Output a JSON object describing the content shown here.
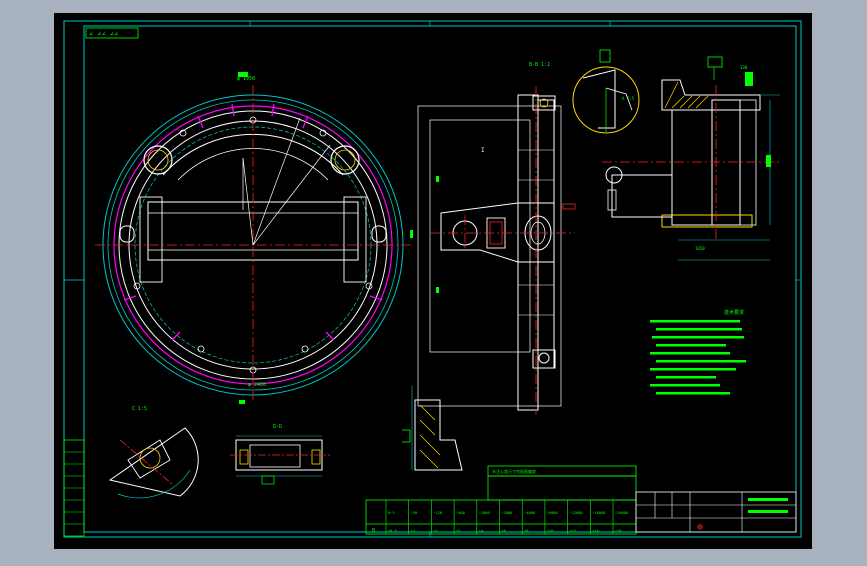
{
  "drawing": {
    "background_color": "#000000",
    "viewport_color": "#a9b2bf",
    "frame_color": "#00c8c8",
    "outline_color": "#ffffff",
    "centerline_color": "#ff2020",
    "dimension_color": "#00ff00",
    "hidden_color": "#ff00ff",
    "hatch_color": "#ffd700"
  },
  "labels": {
    "top_left_note": "∠ ∠∠ ∠∠",
    "view_label_side": "B-B 1:2",
    "detail_label": "I",
    "detail_scale_top": "A 1:5",
    "section_label_small": "C 1:5",
    "section_label_bottom": "D-D",
    "dim_top": "φ 1950",
    "dim_outer": "φ 2400",
    "dim_side_top": "130",
    "dim_side_width": "1050",
    "tech_title": "技术要求"
  },
  "tolerance_table": {
    "header": "未注公差尺寸的极限偏差",
    "row_ranges": [
      "0~3",
      "~30",
      "~120",
      "~400",
      "~1000",
      "~2000",
      "~4000",
      "~8000",
      "~12000",
      "~16000",
      "~20000"
    ],
    "row_values": [
      "±0.5",
      "±1",
      "±2",
      "±3",
      "±4",
      "±6",
      "±8",
      "±10",
      "±12",
      "±14",
      "±16"
    ],
    "grade": "B"
  },
  "title_block": {
    "cells": [
      "",
      "",
      "",
      "",
      "",
      ""
    ],
    "projection_symbol": "⊕"
  }
}
